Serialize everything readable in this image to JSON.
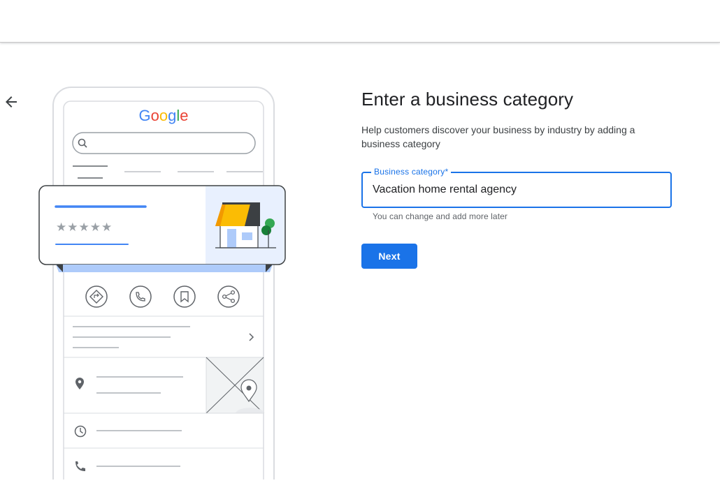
{
  "page": {
    "title": "Enter a business category",
    "subtitle": "Help customers discover your business by industry by adding a business category"
  },
  "illustration": {
    "logo_text": "Google",
    "logo_colors": [
      "#4285F4",
      "#EA4335",
      "#FBBC05",
      "#4285F4",
      "#34A853",
      "#EA4335"
    ],
    "rating_stars": "★★★★★",
    "icons": [
      "directions-icon",
      "phone-icon",
      "bookmark-icon",
      "share-icon",
      "location-pin-icon",
      "clock-icon",
      "phone-icon",
      "chevron-right-icon",
      "storefront-icon",
      "map-icon"
    ]
  },
  "form": {
    "field_label": "Business category*",
    "field_value": "Vacation home rental agency",
    "helper_text": "You can change and add more later",
    "next_label": "Next"
  },
  "colors": {
    "accent": "#1a73e8",
    "awning": "#FBBC04",
    "card_blue": "#e8f0fe",
    "tree": "#34A853"
  }
}
